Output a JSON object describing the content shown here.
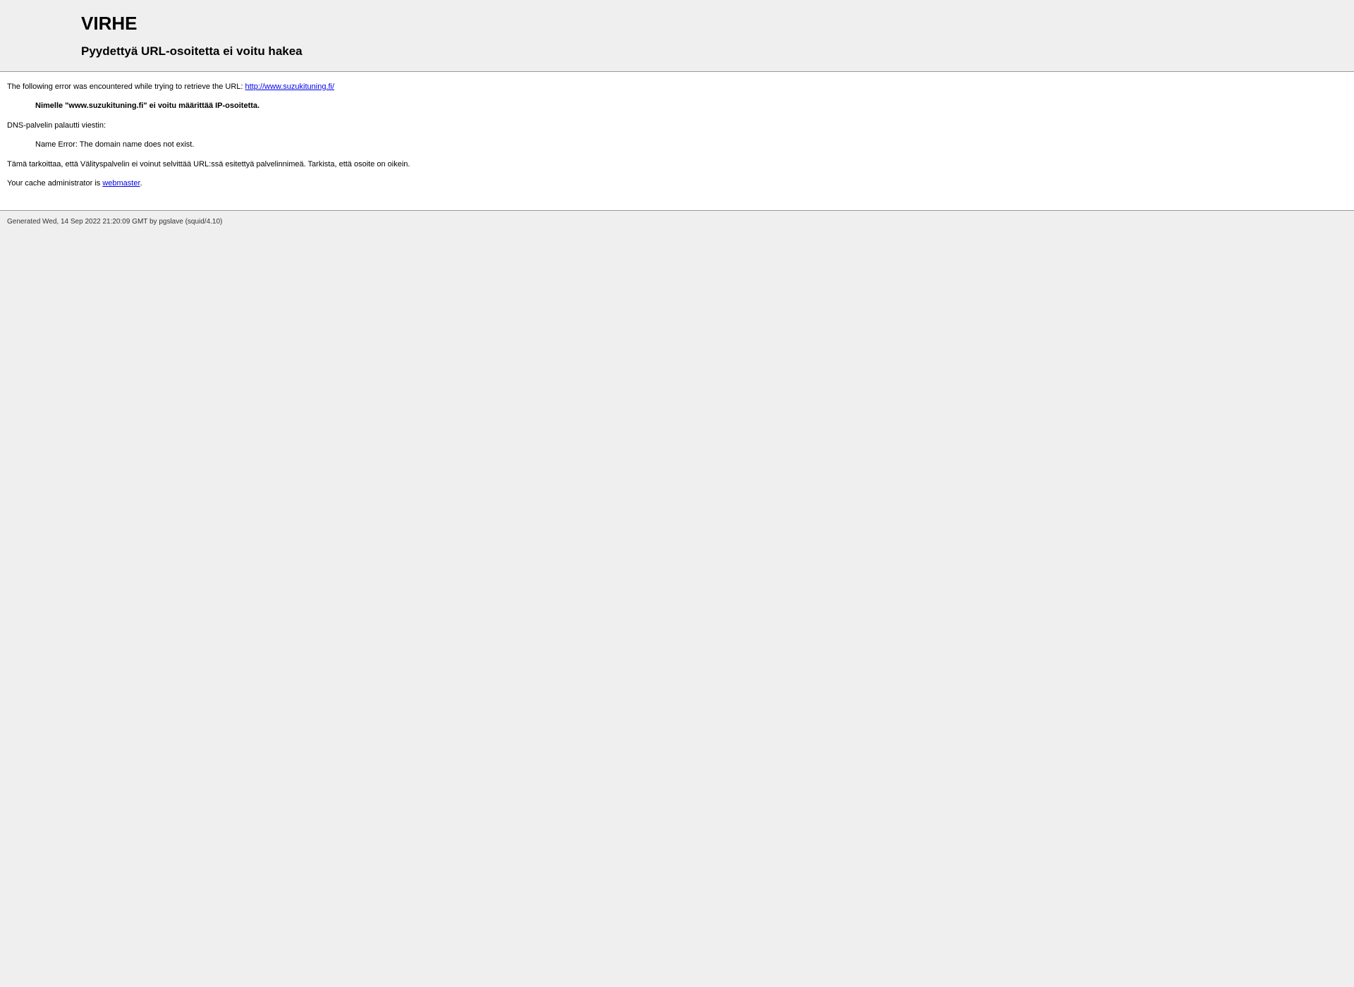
{
  "header": {
    "title": "VIRHE",
    "subtitle": "Pyydettyä URL-osoitetta ei voitu hakea"
  },
  "content": {
    "error_intro": "The following error was encountered while trying to retrieve the URL: ",
    "url": "http://www.suzukituning.fi/",
    "error_name": "Nimelle \"www.suzukituning.fi\" ei voitu määrittää IP-osoitetta.",
    "dns_message_label": "DNS-palvelin palautti viestin:",
    "dns_message": "Name Error: The domain name does not exist.",
    "explanation": "Tämä tarkoittaa, että Välityspalvelin ei voinut selvittää URL:ssä esitettyä palvelinnimeä. Tarkista, että osoite on oikein.",
    "cache_admin_text": "Your cache administrator is ",
    "cache_admin_link": "webmaster",
    "cache_admin_suffix": "."
  },
  "footer": {
    "generated": "Generated Wed, 14 Sep 2022 21:20:09 GMT by pgslave (squid/4.10)"
  }
}
